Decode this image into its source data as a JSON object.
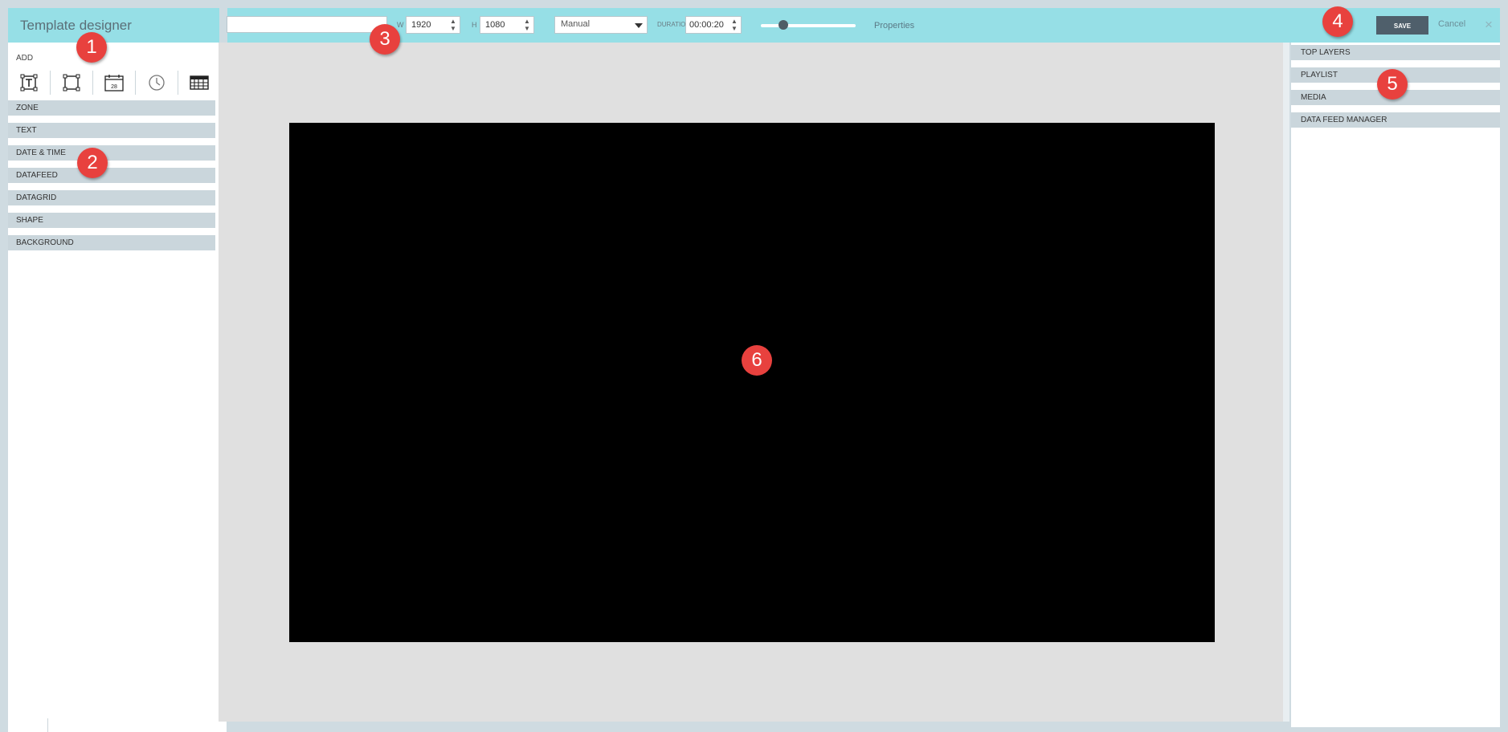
{
  "header": {
    "title": "Template designer",
    "name_value": "",
    "width_label": "W",
    "width_value": "1920",
    "height_label": "H",
    "height_value": "1080",
    "mode_value": "Manual",
    "duration_label": "DURATION",
    "duration_value": "00:00:20",
    "zoom_level": 0.3,
    "properties_label": "Properties",
    "save_label": "SAVE",
    "cancel_label": "Cancel",
    "close_glyph": "×"
  },
  "left_panel": {
    "add_label": "ADD",
    "tools": [
      {
        "icon": "text-zone-icon"
      },
      {
        "icon": "zone-icon"
      },
      {
        "icon": "calendar-icon",
        "text": "28"
      },
      {
        "icon": "clock-icon"
      },
      {
        "icon": "grid-icon"
      }
    ],
    "sections": [
      "ZONE",
      "TEXT",
      "DATE & TIME",
      "DATAFEED",
      "DATAGRID",
      "SHAPE",
      "BACKGROUND"
    ]
  },
  "right_panel": {
    "sections": [
      "TOP LAYERS",
      "PLAYLIST",
      "MEDIA",
      "DATA FEED MANAGER"
    ]
  },
  "markers": [
    "1",
    "2",
    "3",
    "4",
    "5",
    "6"
  ]
}
